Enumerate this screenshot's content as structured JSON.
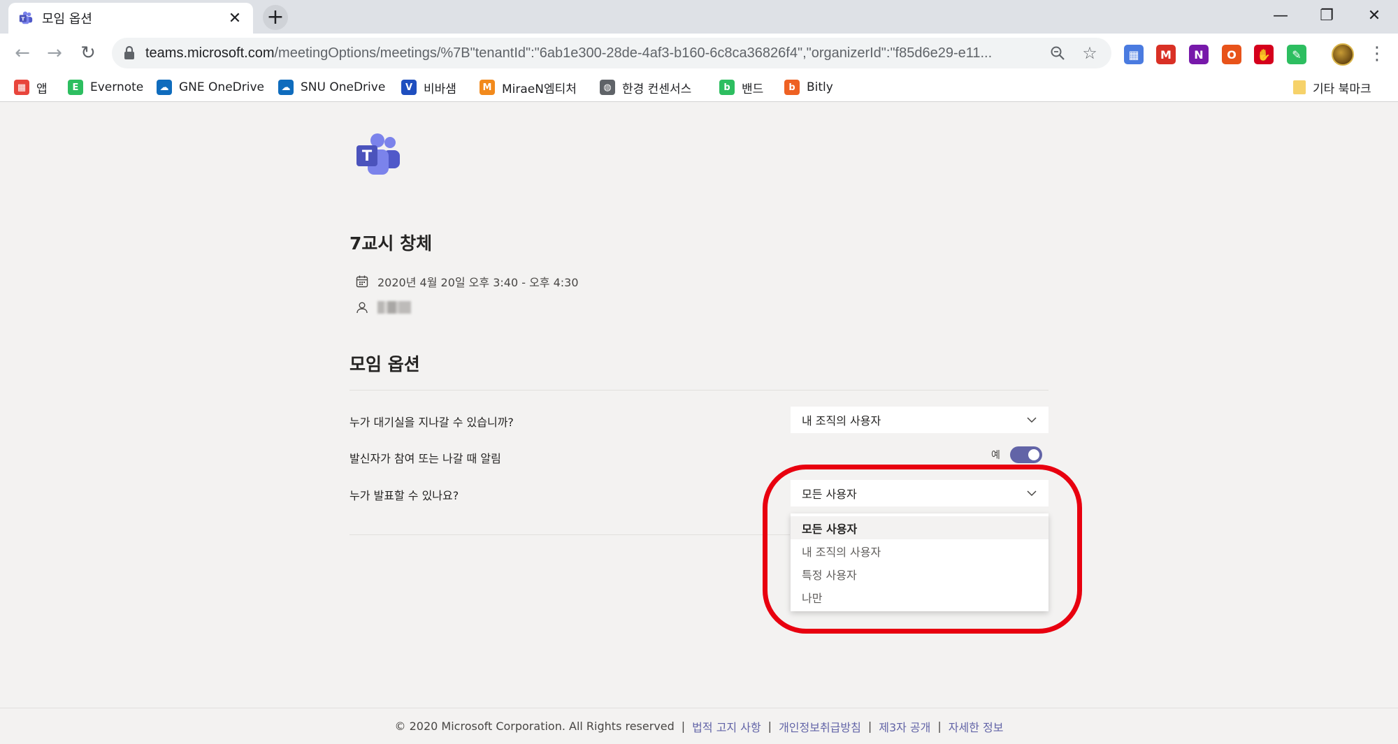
{
  "browser": {
    "tab": {
      "title": "모임 옵션",
      "close": "✕"
    },
    "new_tab": "+",
    "window_controls": {
      "minimize": "—",
      "restore": "❐",
      "close": "✕"
    },
    "nav": {
      "back": "←",
      "forward": "→",
      "reload": "↻"
    },
    "address": {
      "host": "teams.microsoft.com",
      "path": "/meetingOptions/meetings/%7B\"tenantId\":\"6ab1e300-28de-4af3-b160-6c8ca36826f4\",\"organizerId\":\"f85d6e29-e11..."
    },
    "menu": "⋮",
    "extensions": [
      {
        "name": "calendar-extension-icon",
        "glyph": "▦",
        "color": "#4a7be0"
      },
      {
        "name": "gmail-extension-icon",
        "glyph": "M",
        "color": "#d93025"
      },
      {
        "name": "onenote-extension-icon",
        "glyph": "N",
        "color": "#7719aa"
      },
      {
        "name": "office-extension-icon",
        "glyph": "O",
        "color": "#e8531a"
      },
      {
        "name": "adblock-extension-icon",
        "glyph": "✋",
        "color": "#d5001c"
      },
      {
        "name": "evernote-extension-icon",
        "glyph": "✎",
        "color": "#2dbe60"
      }
    ],
    "bookmarks": [
      {
        "name": "bookmark-apps",
        "label": "앱",
        "glyph": "▦",
        "color": "#e8453c"
      },
      {
        "name": "bookmark-evernote",
        "label": "Evernote",
        "glyph": "E",
        "color": "#2dbe60"
      },
      {
        "name": "bookmark-gne-onedrive",
        "label": "GNE OneDrive",
        "glyph": "☁",
        "color": "#0f6cbd"
      },
      {
        "name": "bookmark-snu-onedrive",
        "label": "SNU OneDrive",
        "glyph": "☁",
        "color": "#0f6cbd"
      },
      {
        "name": "bookmark-visang",
        "label": "비바샘",
        "glyph": "V",
        "color": "#1f4fbf"
      },
      {
        "name": "bookmark-miraen",
        "label": "MiraeN엠티처",
        "glyph": "M",
        "color": "#f28a1c"
      },
      {
        "name": "bookmark-hankyung",
        "label": "한경 컨센서스",
        "glyph": "◍",
        "color": "#5f6368"
      },
      {
        "name": "bookmark-band",
        "label": "밴드",
        "glyph": "b",
        "color": "#2dbe60"
      },
      {
        "name": "bookmark-bitly",
        "label": "Bitly",
        "glyph": "b",
        "color": "#ee6123"
      }
    ],
    "other_bookmarks": "기타 북마크"
  },
  "meeting": {
    "title": "7교시 창체",
    "datetime": "2020년 4월 20일 오후 3:40 - 오후 4:30"
  },
  "options": {
    "section_title": "모임 옵션",
    "lobby": {
      "label": "누가 대기실을 지나갈 수 있습니까?",
      "value": "내 조직의 사용자"
    },
    "notify": {
      "label": "발신자가 참여 또는 나갈 때 알림",
      "toggle_label": "예",
      "on": true
    },
    "presenter": {
      "label": "누가 발표할 수 있나요?",
      "value": "모든 사용자",
      "choices": [
        "모든 사용자",
        "내 조직의 사용자",
        "특정 사용자",
        "나만"
      ],
      "selected_index": 0
    }
  },
  "footer": {
    "copyright": "© 2020 Microsoft Corporation. All Rights reserved",
    "links": [
      "법적 고지 사항",
      "개인정보취급방침",
      "제3자 공개",
      "자세한 정보"
    ],
    "separator": "|"
  },
  "colors": {
    "accent": "#6264a7",
    "highlight": "#e8000f"
  }
}
